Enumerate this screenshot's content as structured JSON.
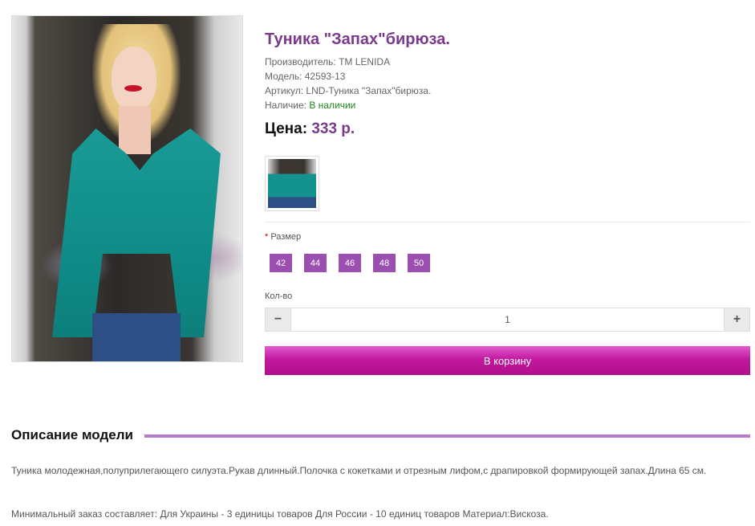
{
  "product": {
    "title": "Туника \"Запах\"бирюза.",
    "manufacturer": "Производитель: TM LENIDA",
    "model": "Модель: 42593-13",
    "sku": "Артикул: LND-Туника \"Запах\"бирюза.",
    "availability_label": "Наличие: ",
    "availability_value": "В наличии",
    "price_label": "Цена: ",
    "price_value": "333 р."
  },
  "options": {
    "required_mark": "*",
    "size_label": " Размер",
    "sizes": [
      "42",
      "44",
      "46",
      "48",
      "50"
    ]
  },
  "quantity": {
    "label": "Кол-во",
    "value": "1",
    "minus": "−",
    "plus": "+"
  },
  "cart": {
    "button_label": "В корзину"
  },
  "description": {
    "heading": "Описание модели",
    "text1": "Туника молодежная,полуприлегающего силуэта.Рукав длинный.Полочка с кокетками и отрезным лифом,с драпировкой формирующей запах.Длина 65 см.",
    "text2": "Минимальный заказ составляет: Для Украины - 3 единицы товаров Для России - 10 единиц товаров Материал:Вискоза."
  },
  "colors": {
    "accent": "#7a3a8c",
    "size_button": "#9b4fb0",
    "cart_button": "#c2189f",
    "in_stock": "#1a8a1a"
  }
}
